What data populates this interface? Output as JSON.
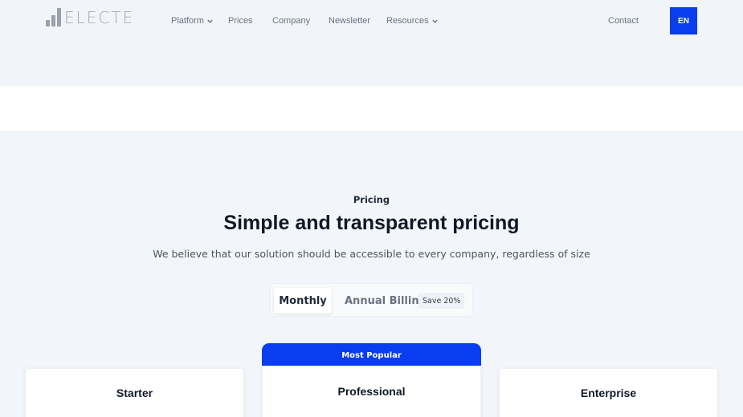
{
  "brand": {
    "name": "ELECTE"
  },
  "nav": {
    "items": [
      {
        "label": "Platform",
        "has_dropdown": true
      },
      {
        "label": "Prices",
        "has_dropdown": false
      },
      {
        "label": "Company",
        "has_dropdown": false
      },
      {
        "label": "Newsletter",
        "has_dropdown": false
      },
      {
        "label": "Resources",
        "has_dropdown": true
      }
    ],
    "contact_label": "Contact",
    "language_label": "EN"
  },
  "pricing": {
    "eyebrow": "Pricing",
    "title": "Simple and transparent pricing",
    "subtitle": "We believe that our solution should be accessible to every company, regardless of size",
    "billing_toggle": {
      "monthly_label": "Monthly",
      "annual_label": "Annual Billing",
      "save_badge": "Save 20%",
      "selected": "Monthly"
    },
    "plans": [
      {
        "name": "Starter"
      },
      {
        "name": "Professional",
        "badge": "Most Popular"
      },
      {
        "name": "Enterprise"
      }
    ]
  },
  "colors": {
    "accent": "#0a3cf0",
    "page_background": "#f2f5f9",
    "text_primary": "#111827",
    "text_muted": "#6b7280"
  },
  "icons": {
    "dropdown": "chevron-down-icon",
    "logo": "bar-chart-logo-icon"
  }
}
